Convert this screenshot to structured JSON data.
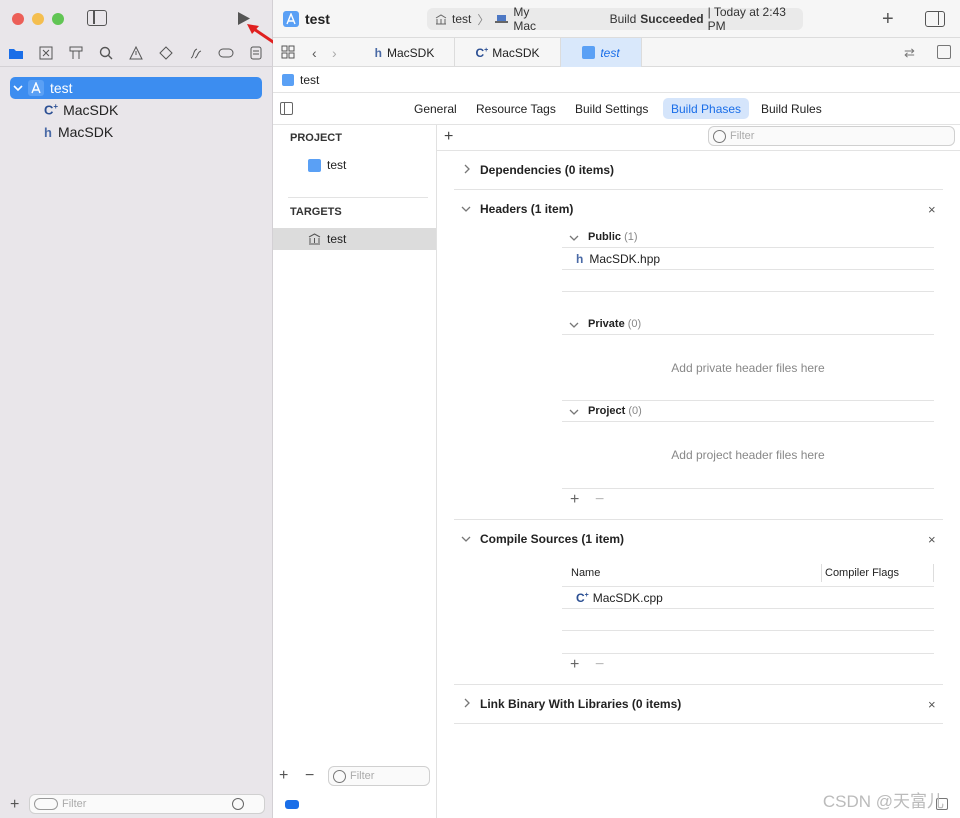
{
  "window": {
    "title": "test"
  },
  "toolbar": {
    "scheme_project": "test",
    "scheme_device": "My Mac",
    "build_status_prefix": "Build",
    "build_status_result": "Succeeded",
    "build_status_time": "| Today at 2:43 PM"
  },
  "navigator": {
    "tree": [
      {
        "label": "test",
        "icon": "xcode-project-icon",
        "selected": true
      },
      {
        "label": "MacSDK",
        "icon": "cpp-file-icon"
      },
      {
        "label": "MacSDK",
        "icon": "header-file-icon"
      }
    ],
    "filter_placeholder": "Filter"
  },
  "tabs": [
    {
      "label": "MacSDK",
      "icon": "header-file-icon"
    },
    {
      "label": "MacSDK",
      "icon": "cpp-file-icon"
    },
    {
      "label": "test",
      "icon": "xcode-project-icon",
      "active": true
    }
  ],
  "breadcrumb": {
    "label": "test"
  },
  "editor_tabs": [
    {
      "label": "General"
    },
    {
      "label": "Resource Tags"
    },
    {
      "label": "Build Settings"
    },
    {
      "label": "Build Phases",
      "active": true
    },
    {
      "label": "Build Rules"
    }
  ],
  "project_list": {
    "project_header": "PROJECT",
    "project_item": "test",
    "targets_header": "TARGETS",
    "target_item": "test",
    "filter_placeholder": "Filter"
  },
  "phases": {
    "filter_placeholder": "Filter",
    "dependencies": {
      "title": "Dependencies (0 items)"
    },
    "headers": {
      "title": "Headers (1 item)",
      "public_label": "Public",
      "public_count": "(1)",
      "public_file": "MacSDK.hpp",
      "private_label": "Private",
      "private_count": "(0)",
      "private_hint": "Add private header files here",
      "project_label": "Project",
      "project_count": "(0)",
      "project_hint": "Add project header files here"
    },
    "compile": {
      "title": "Compile Sources (1 item)",
      "col_name": "Name",
      "col_flags": "Compiler Flags",
      "file": "MacSDK.cpp"
    },
    "link": {
      "title": "Link Binary With Libraries (0 items)"
    }
  },
  "watermark": "CSDN @天富儿",
  "colors": {
    "accent": "#1a6ee8",
    "selection": "#3c8df0",
    "close": "#ec5f58",
    "minimize": "#f4be4f",
    "zoom": "#61c554",
    "annotation_arrow": "#e02020"
  }
}
